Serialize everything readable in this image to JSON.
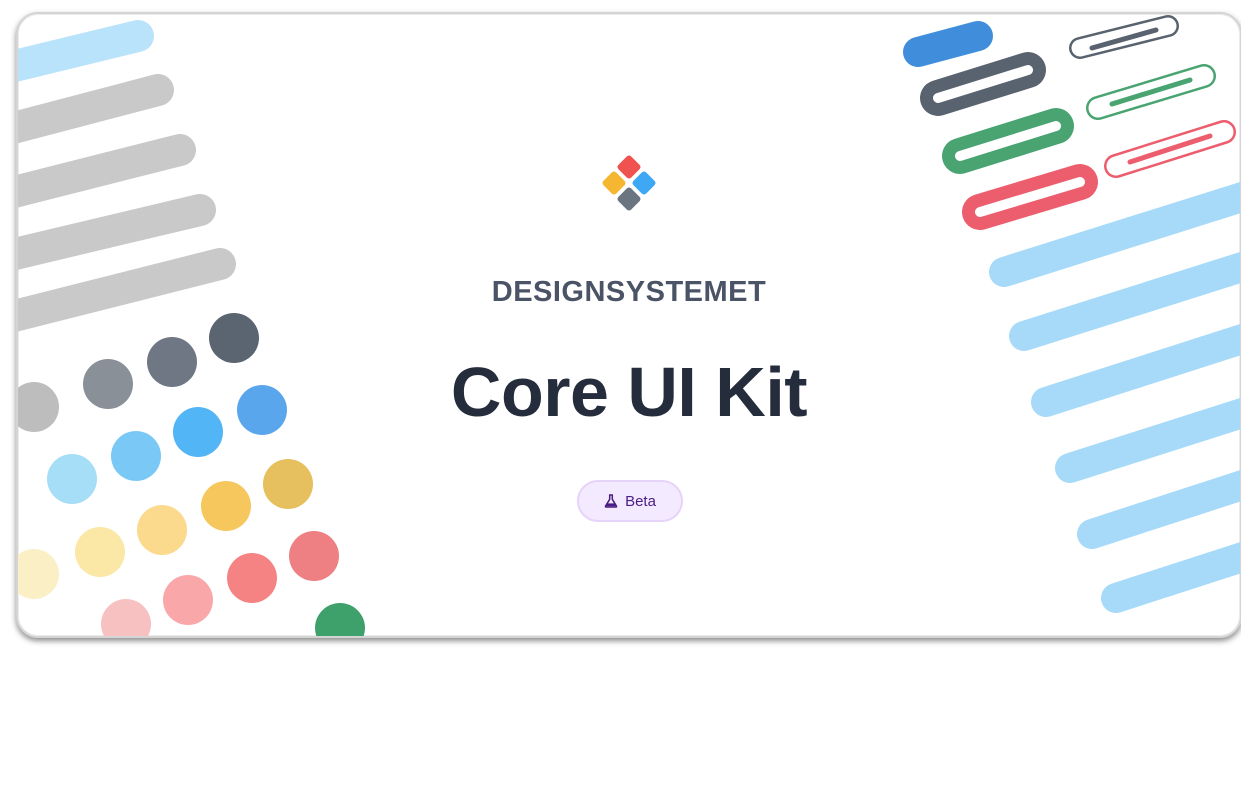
{
  "card": {
    "brand": "DESIGNSYSTEMET",
    "title": "Core UI Kit",
    "badge": {
      "label": "Beta",
      "icon": "flask-icon"
    },
    "logo": {
      "icon": "designsystemet-logo-icon",
      "colors": [
        "#f0524f",
        "#f5b731",
        "#3fa8f5",
        "#6b7582"
      ]
    }
  },
  "colors": {
    "text_dark": "#252d3d",
    "text_muted": "#4a5466",
    "badge_bg": "#f3eaff",
    "badge_text": "#4b1d84",
    "grey_stripe": "#c9c9c9",
    "blue_stripe": "#a6daf8",
    "dot_grey": [
      "#bdbdbd",
      "#8a9098",
      "#707784",
      "#5b6572"
    ],
    "dot_blue": [
      "#a6ddf7",
      "#79c8f5",
      "#52b5f5",
      "#5aa6ec"
    ],
    "dot_yellow": [
      "#fbe7a6",
      "#fbd98d",
      "#f6c75d",
      "#e6c05e"
    ],
    "dot_red": [
      "#f8c1c1",
      "#f9a7a9",
      "#f68383",
      "#ee7f83"
    ],
    "dot_green": "#3ea06a"
  }
}
